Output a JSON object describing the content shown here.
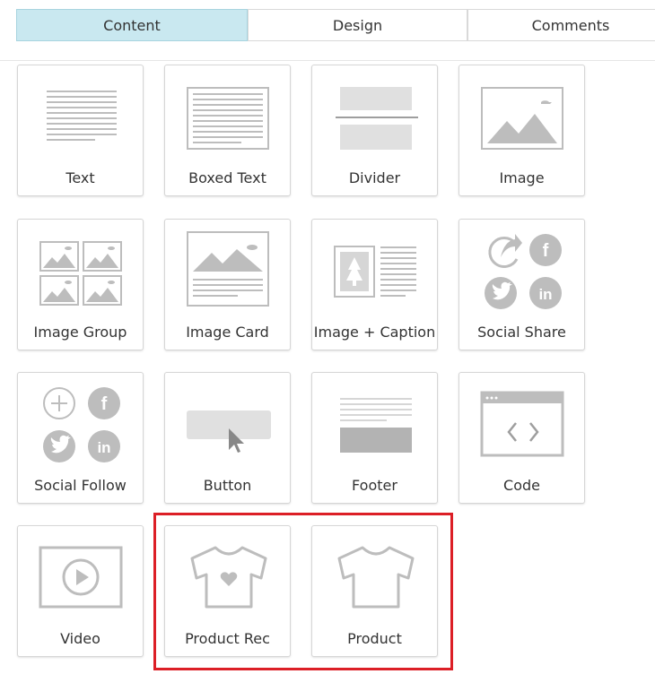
{
  "tabs": [
    {
      "label": "Content",
      "active": true
    },
    {
      "label": "Design",
      "active": false
    },
    {
      "label": "Comments",
      "active": false
    }
  ],
  "blocks": [
    {
      "label": "Text",
      "icon": "text-lines-icon"
    },
    {
      "label": "Boxed Text",
      "icon": "boxed-text-icon"
    },
    {
      "label": "Divider",
      "icon": "divider-icon"
    },
    {
      "label": "Image",
      "icon": "image-icon"
    },
    {
      "label": "Image Group",
      "icon": "image-group-icon"
    },
    {
      "label": "Image Card",
      "icon": "image-card-icon"
    },
    {
      "label": "Image + Caption",
      "icon": "image-caption-icon"
    },
    {
      "label": "Social Share",
      "icon": "social-share-icon"
    },
    {
      "label": "Social Follow",
      "icon": "social-follow-icon"
    },
    {
      "label": "Button",
      "icon": "button-cursor-icon"
    },
    {
      "label": "Footer",
      "icon": "footer-icon"
    },
    {
      "label": "Code",
      "icon": "code-window-icon"
    },
    {
      "label": "Video",
      "icon": "video-play-icon"
    },
    {
      "label": "Product Rec",
      "icon": "tshirt-heart-icon"
    },
    {
      "label": "Product",
      "icon": "tshirt-icon"
    }
  ],
  "social_glyphs": {
    "facebook": "f",
    "linkedin": "in"
  },
  "colors": {
    "active_tab": "#c9e8f0",
    "icon_gray": "#bdbdbd",
    "highlight_border": "#dc1f26"
  }
}
